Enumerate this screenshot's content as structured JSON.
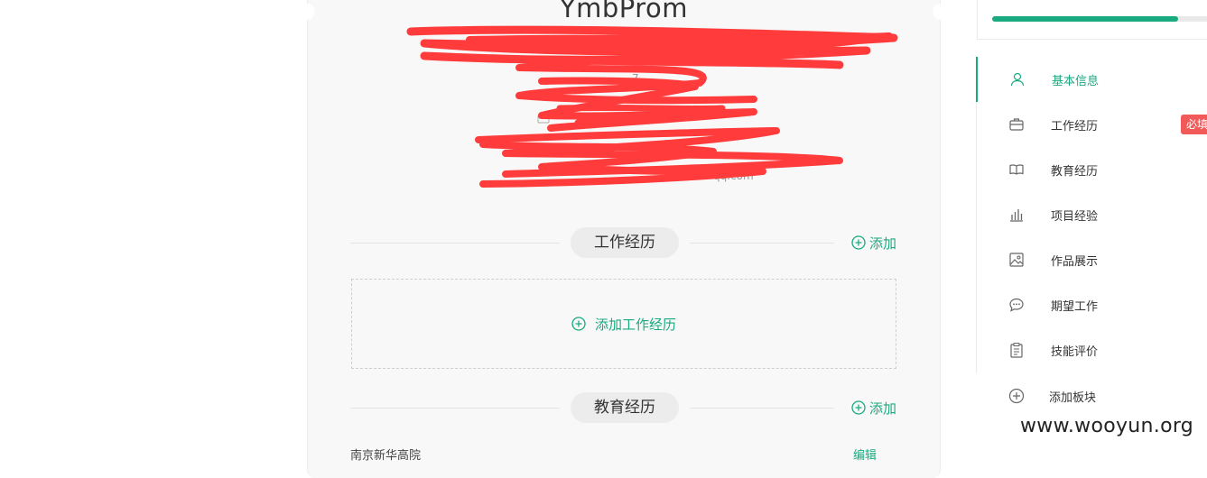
{
  "resume": {
    "name": "YmbProm",
    "faint_fragments": [
      "7",
      "qq.com"
    ]
  },
  "sections": {
    "work": {
      "title": "工作经历",
      "add_label": "添加",
      "add_box_label": "添加工作经历"
    },
    "education": {
      "title": "教育经历",
      "add_label": "添加"
    }
  },
  "cut_off_entry": {
    "text": "南京新华高院",
    "action": "编辑"
  },
  "progress": {
    "value": 0.86,
    "color": "#1aaa80"
  },
  "sidebar": {
    "items": [
      {
        "label": "基本信息",
        "icon": "user-icon",
        "active": true
      },
      {
        "label": "工作经历",
        "icon": "briefcase-icon",
        "badge": "必填"
      },
      {
        "label": "教育经历",
        "icon": "book-icon"
      },
      {
        "label": "项目经验",
        "icon": "bar-chart-icon"
      },
      {
        "label": "作品展示",
        "icon": "image-icon"
      },
      {
        "label": "期望工作",
        "icon": "chat-icon"
      },
      {
        "label": "技能评价",
        "icon": "clipboard-icon"
      }
    ],
    "add_block_label": "添加板块"
  },
  "colors": {
    "accent": "#1aaa80",
    "badge": "#f25a5a",
    "redaction": "#ff3b3b"
  },
  "watermark": "www.wooyun.org"
}
